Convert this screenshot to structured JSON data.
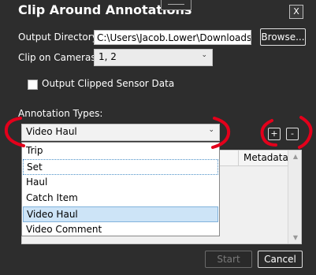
{
  "window": {
    "title": "Clip Around Annotations",
    "close_label": "X"
  },
  "form": {
    "output_directory_label": "Output Directory:",
    "output_directory_value": "C:\\Users\\Jacob.Lower\\Downloads",
    "browse_label": "Browse...",
    "clip_on_cameras_label": "Clip on Cameras:",
    "clip_on_cameras_value": "1, 2",
    "output_clipped_label": "Output Clipped Sensor Data",
    "output_clipped_checked": false,
    "annotation_types_label": "Annotation Types:",
    "annotation_type_selected": "Video Haul",
    "add_label": "+",
    "remove_label": "-"
  },
  "grid": {
    "columns": [
      "Metadata"
    ]
  },
  "dropdown": {
    "items": [
      "Trip",
      "Set",
      "Haul",
      "Catch Item",
      "Video Haul",
      "Video Comment"
    ],
    "focused": "Set",
    "selected": "Video Haul"
  },
  "footer": {
    "start_label": "Start",
    "cancel_label": "Cancel"
  },
  "colors": {
    "annotation_red": "#e3001b",
    "dialog_bg": "#2d2d2d",
    "selection_bg": "#cde4f7"
  }
}
